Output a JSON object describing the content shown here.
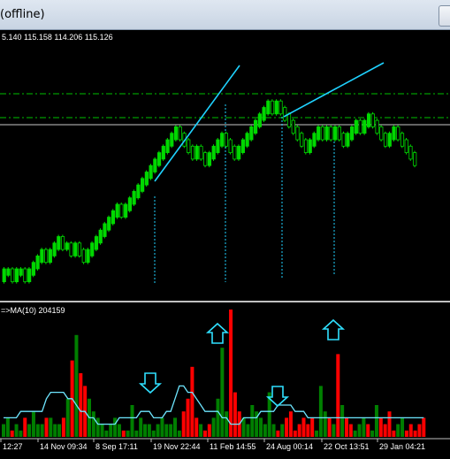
{
  "window": {
    "title": "(offline)"
  },
  "price_panel": {
    "ohlc_text": "5.140 115.158 114.206 115.126",
    "colors": {
      "up": "#00d800",
      "down": "#00d800",
      "trendline": "#1fd2ff",
      "level": "#00c000",
      "vline": "#1fd2ff"
    }
  },
  "volume_panel": {
    "indicator_text": "=>MA(10) 204159",
    "colors": {
      "bar_up": "#007f00",
      "bar_down": "#ff0000",
      "ma": "#6ee6ff",
      "arrow": "#2fe0ff"
    },
    "time_labels": [
      "12:27",
      "14 Nov 09:34",
      "8 Sep 17:11",
      "19 Nov 22:44",
      "11 Feb 14:55",
      "24 Aug 00:14",
      "22 Oct 13:51",
      "29 Jan 04:21"
    ]
  },
  "chart_data": [
    {
      "type": "ohlc",
      "series": [
        {
          "name": "",
          "close": [
            0,
            0,
            -1,
            0,
            0,
            -1,
            0,
            1,
            2,
            3,
            2,
            3,
            4,
            5,
            4,
            4,
            3,
            4,
            3,
            2,
            3,
            4,
            5,
            6,
            7,
            8,
            9,
            10,
            9,
            10,
            11,
            12,
            13,
            14,
            15,
            16,
            17,
            18,
            19,
            20,
            21,
            22,
            21,
            20,
            19,
            18,
            19,
            18,
            17,
            18,
            19,
            20,
            21,
            20,
            19,
            18,
            19,
            20,
            21,
            22,
            23,
            24,
            25,
            26,
            25,
            26,
            25,
            24,
            23,
            22,
            21,
            20,
            19,
            20,
            21,
            22,
            21,
            22,
            21,
            22,
            21,
            20,
            21,
            22,
            23,
            22,
            23,
            24,
            23,
            22,
            21,
            20,
            21,
            22,
            21,
            20,
            19,
            18,
            17
          ]
        }
      ]
    },
    {
      "type": "bar",
      "series": [
        {
          "name": "",
          "values": [
            2,
            3,
            1,
            2,
            1,
            3,
            2,
            4,
            2,
            2,
            3,
            3,
            2,
            2,
            3,
            6,
            12,
            16,
            10,
            8,
            6,
            4,
            3,
            2,
            1,
            2,
            3,
            2,
            1,
            1,
            5,
            1,
            3,
            2,
            2,
            1,
            2,
            3,
            2,
            2,
            3,
            1,
            4,
            6,
            11,
            3,
            2,
            1,
            2,
            3,
            6,
            14,
            4,
            20,
            7,
            4,
            3,
            2,
            5,
            4,
            3,
            2,
            7,
            2,
            1,
            2,
            3,
            4,
            1,
            2,
            3,
            2,
            3,
            1,
            8,
            4,
            3,
            2,
            13,
            5,
            3,
            2,
            1,
            2,
            3,
            2,
            1,
            5,
            3,
            2,
            4,
            1,
            2,
            3,
            1,
            2,
            1,
            2,
            3
          ]
        },
        {
          "name": "MA(10)",
          "values": [
            3,
            3,
            3,
            3,
            4,
            4,
            4,
            4,
            4,
            4,
            6,
            7,
            7,
            7,
            7,
            6,
            6,
            5,
            4,
            4,
            3,
            3,
            2,
            2,
            2,
            2,
            2,
            3,
            3,
            3,
            3,
            3,
            4,
            4,
            4,
            3,
            3,
            3,
            4,
            4,
            6,
            8,
            8,
            7,
            7,
            6,
            5,
            4,
            4,
            4,
            4,
            3,
            3,
            2,
            2,
            2,
            3,
            3,
            3,
            3,
            4,
            4,
            4,
            4,
            5,
            5,
            5,
            5,
            4,
            4,
            4,
            3,
            3,
            3,
            3,
            3,
            3,
            3,
            3,
            3,
            3,
            3,
            3,
            3,
            3,
            3,
            3,
            3,
            3,
            3,
            3,
            3,
            3,
            3,
            3,
            3,
            3,
            3,
            3
          ]
        }
      ]
    }
  ]
}
